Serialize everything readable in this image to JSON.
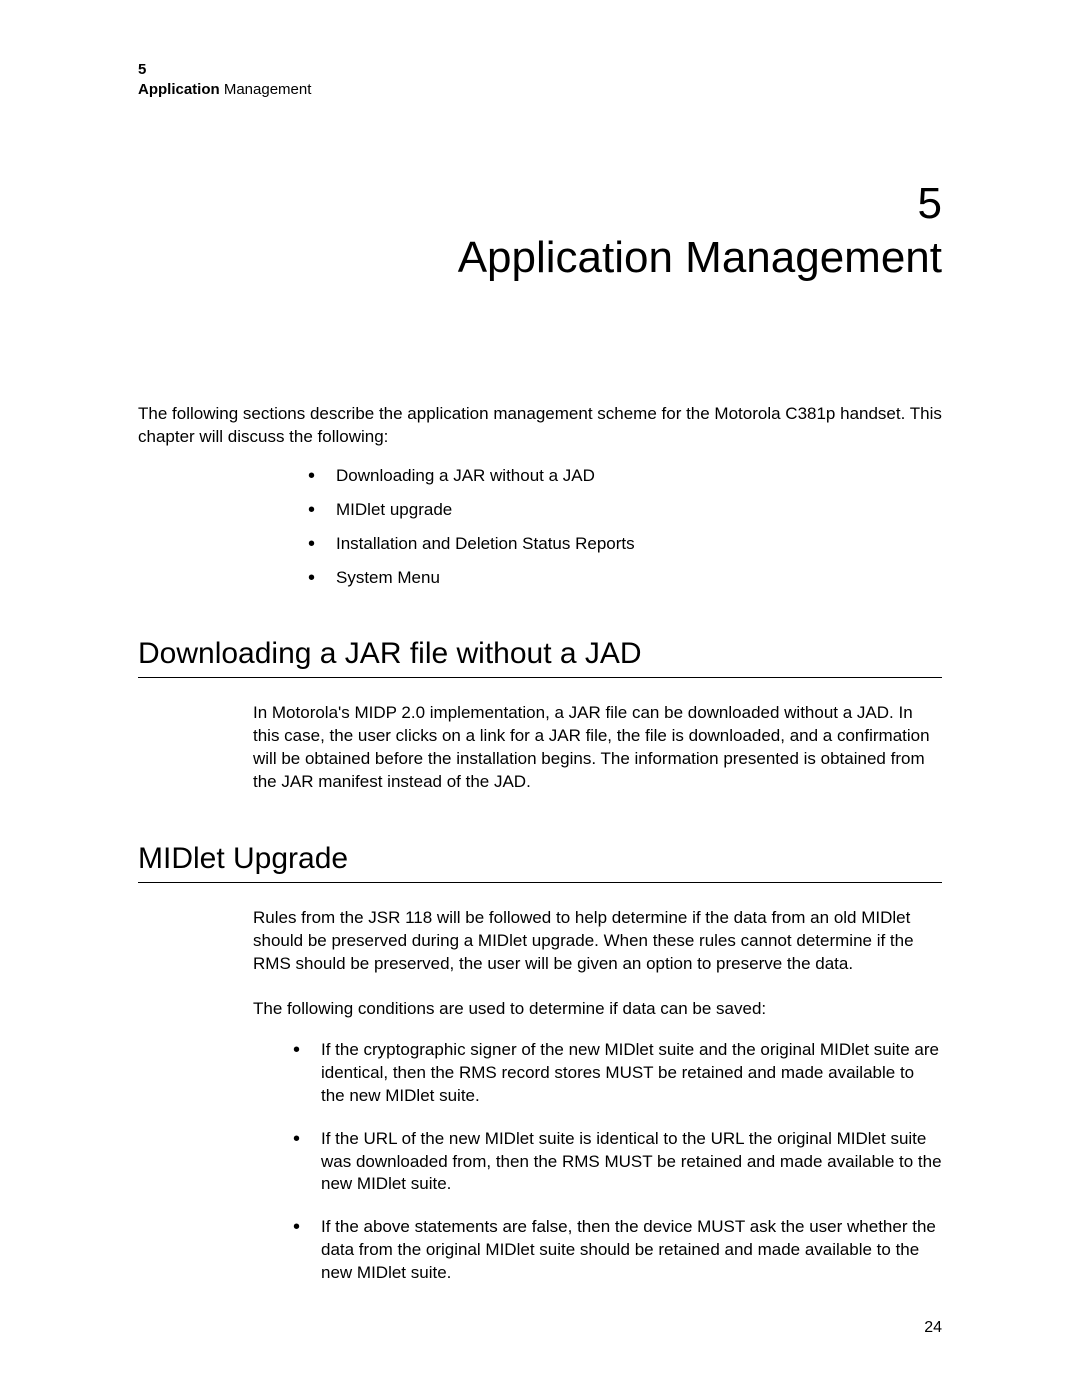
{
  "runningHead": {
    "chapterNumber": "5",
    "chapterTitleBold": "Application",
    "chapterTitleRest": " Management"
  },
  "chapter": {
    "number": "5",
    "title": "Application Management"
  },
  "intro": "The following sections describe the application management scheme for the Motorola C381p handset. This chapter will discuss the following:",
  "introBullets": [
    "Downloading a JAR without a JAD",
    "MIDlet upgrade",
    "Installation and Deletion Status Reports",
    "System Menu"
  ],
  "section1": {
    "title": "Downloading a JAR file without a JAD",
    "paragraphs": [
      "In Motorola's MIDP 2.0 implementation, a JAR file can be downloaded without a JAD. In this case, the user clicks on a link for a JAR file, the file is downloaded, and a confirmation will be obtained before the installation begins. The information presented is obtained from the JAR manifest instead of the JAD."
    ]
  },
  "section2": {
    "title": "MIDlet Upgrade",
    "paragraphs": [
      "Rules from the JSR 118 will be followed to help determine if the data from an old MIDlet should be preserved during a MIDlet upgrade. When these rules cannot determine if the RMS should be preserved, the user will be given an option to preserve the data.",
      "The following conditions are used to determine if data can be saved:"
    ],
    "bullets": [
      "If the cryptographic signer of the new MIDlet suite and the original MIDlet suite are identical, then the RMS record stores MUST be retained and made available to the new MIDlet suite.",
      "If the URL of the new MIDlet suite is identical to the URL the original MIDlet suite was downloaded from, then the RMS MUST be retained and made available to the new MIDlet suite.",
      "If the above statements are false, then the device MUST ask the user whether the data from the original MIDlet suite should be retained and made available to the new MIDlet suite."
    ]
  },
  "pageNumber": "24"
}
